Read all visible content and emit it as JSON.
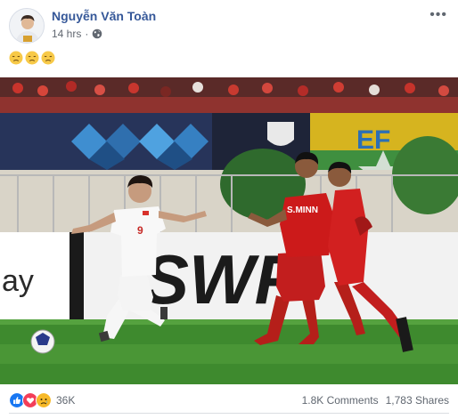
{
  "post": {
    "author": "Nguyễn Văn Toàn",
    "timestamp": "14 hrs",
    "audience_icon": "globe-icon",
    "message_emojis": [
      "disappointed-face",
      "disappointed-face",
      "disappointed-face"
    ],
    "options_icon": "more-options-icon"
  },
  "photo": {
    "jersey_numbers": [
      "9"
    ],
    "name_on_shirt": "S.MINN",
    "board_texts": [
      "ay",
      "SWF"
    ],
    "banner_text": "EF"
  },
  "engagement": {
    "reactions": [
      "like",
      "love",
      "sad"
    ],
    "reaction_count": "36K",
    "comments": "1.8K Comments",
    "shares": "1,783 Shares"
  },
  "colors": {
    "author_link": "#365899",
    "meta_text": "#616770",
    "like_blue": "#1877f2",
    "love_red": "#f33e58",
    "sad_yellow": "#f7b928",
    "pitch_green": "#3e8a2e",
    "myanmar_red": "#cc1a1a"
  }
}
